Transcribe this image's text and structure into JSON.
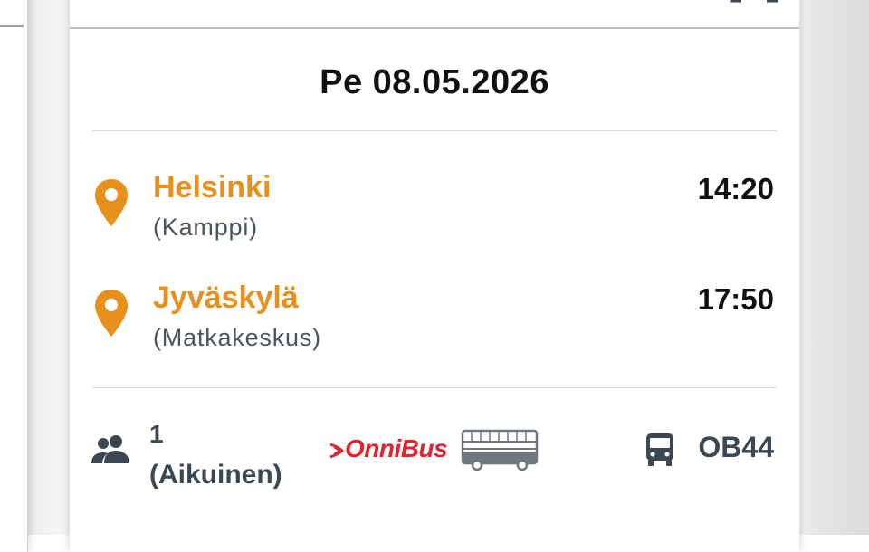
{
  "trip": {
    "date": "Pe 08.05.2026",
    "origin": {
      "name": "Helsinki",
      "station": "(Kamppi)",
      "time": "14:20"
    },
    "destination": {
      "name": "Jyväskylä",
      "station": "(Matkakeskus)",
      "time": "17:50"
    },
    "passengers": {
      "count": "1",
      "type": "(Aikuinen)"
    },
    "operator": {
      "name": "OnniBus"
    },
    "line": "OB44"
  },
  "icons": {
    "pin": "location-pin-icon",
    "passengers": "people-icon",
    "bus": "bus-icon",
    "vehicle": "double-decker-bus-icon"
  },
  "colors": {
    "accent": "#e8901c",
    "operator_red": "#e0242f",
    "text_dark": "#111111",
    "text_muted": "#4a5560",
    "icon_slate": "#3b4752"
  }
}
